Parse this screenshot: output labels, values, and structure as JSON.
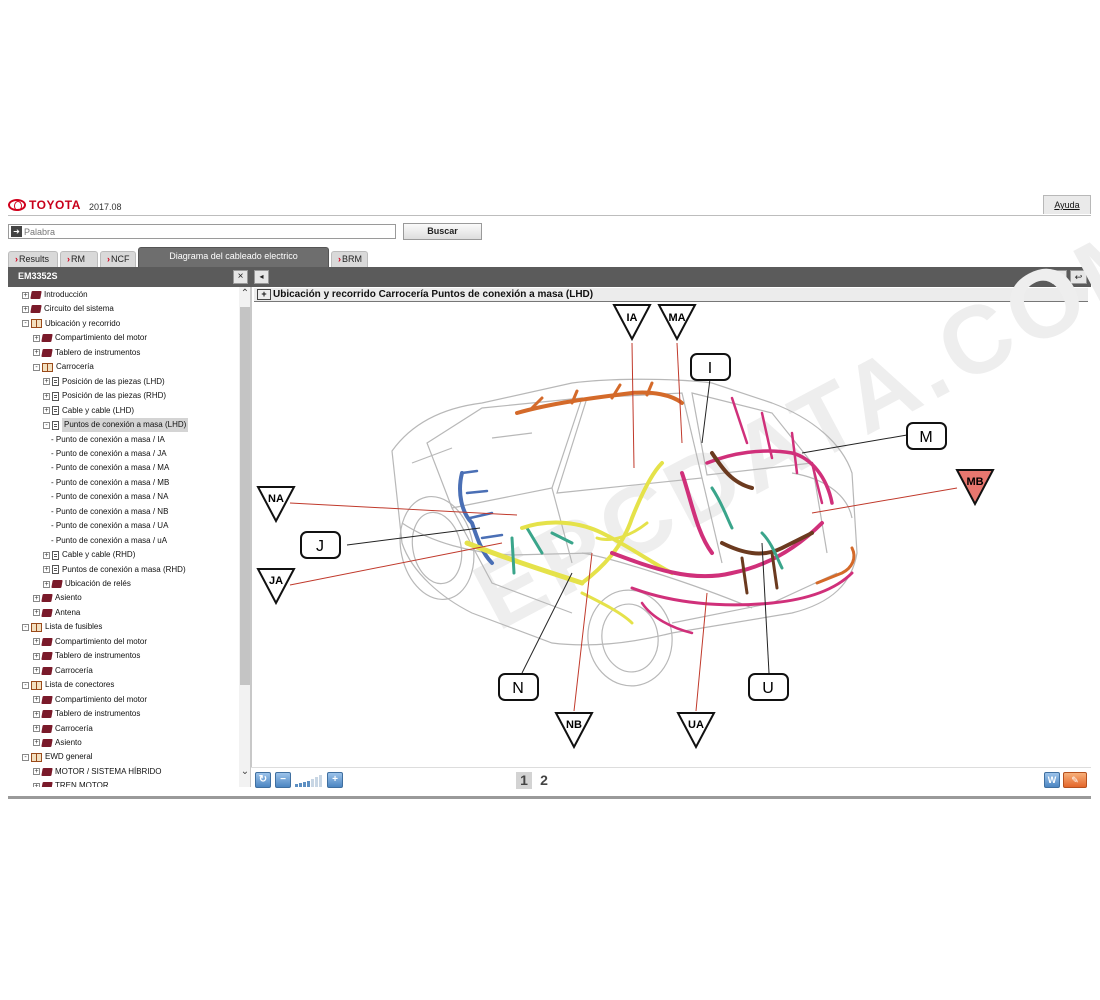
{
  "header": {
    "brand": "TOYOTA",
    "version": "2017.08",
    "help": "Ayuda"
  },
  "search": {
    "placeholder": "Palabra",
    "value": "",
    "button": "Buscar"
  },
  "tabs": [
    {
      "label": "Results"
    },
    {
      "label": "RM"
    },
    {
      "label": "NCF"
    },
    {
      "label": "Diagrama del cableado electrico"
    },
    {
      "label": "BRM"
    }
  ],
  "toolbar": {
    "doc_id": "EM3352S",
    "close": "×",
    "nav": "◂",
    "print": "⎙",
    "back": "↩"
  },
  "breadcrumb": {
    "expand": "+",
    "text": "Ubicación y recorrido  Carrocería  Puntos de conexión a masa (LHD)"
  },
  "tree": [
    {
      "exp": "+",
      "icon": "book",
      "label": "Introducción"
    },
    {
      "exp": "+",
      "icon": "book",
      "label": "Circuito del sistema"
    },
    {
      "exp": "-",
      "icon": "open",
      "label": "Ubicación y recorrido"
    },
    {
      "exp": "+",
      "icon": "book",
      "label": "Compartimiento del motor"
    },
    {
      "exp": "+",
      "icon": "book",
      "label": "Tablero de instrumentos"
    },
    {
      "exp": "-",
      "icon": "open",
      "label": "Carrocería"
    },
    {
      "exp": "+",
      "icon": "doc",
      "label": "Posición de las piezas (LHD)"
    },
    {
      "exp": "+",
      "icon": "doc",
      "label": "Posición de las piezas (RHD)"
    },
    {
      "exp": "+",
      "icon": "doc",
      "label": "Cable y cable (LHD)"
    },
    {
      "exp": "-",
      "icon": "doc",
      "label": "Puntos de conexión a masa (LHD)"
    },
    {
      "exp": "",
      "icon": "",
      "label": "- Punto de conexión a masa / IA"
    },
    {
      "exp": "",
      "icon": "",
      "label": "- Punto de conexión a masa / JA"
    },
    {
      "exp": "",
      "icon": "",
      "label": "- Punto de conexión a masa / MA"
    },
    {
      "exp": "",
      "icon": "",
      "label": "- Punto de conexión a masa / MB"
    },
    {
      "exp": "",
      "icon": "",
      "label": "- Punto de conexión a masa / NA"
    },
    {
      "exp": "",
      "icon": "",
      "label": "- Punto de conexión a masa / NB"
    },
    {
      "exp": "",
      "icon": "",
      "label": "- Punto de conexión a masa / UA"
    },
    {
      "exp": "",
      "icon": "",
      "label": "- Punto de conexión a masa / uA"
    },
    {
      "exp": "+",
      "icon": "doc",
      "label": "Cable y cable (RHD)"
    },
    {
      "exp": "+",
      "icon": "doc",
      "label": "Puntos de conexión a masa (RHD)"
    },
    {
      "exp": "+",
      "icon": "book",
      "label": "Ubicación de relés"
    },
    {
      "exp": "+",
      "icon": "book",
      "label": "Asiento"
    },
    {
      "exp": "+",
      "icon": "book",
      "label": "Antena"
    },
    {
      "exp": "-",
      "icon": "open",
      "label": "Lista de fusibles"
    },
    {
      "exp": "+",
      "icon": "book",
      "label": "Compartimiento del motor"
    },
    {
      "exp": "+",
      "icon": "book",
      "label": "Tablero de instrumentos"
    },
    {
      "exp": "+",
      "icon": "book",
      "label": "Carrocería"
    },
    {
      "exp": "-",
      "icon": "open",
      "label": "Lista de conectores"
    },
    {
      "exp": "+",
      "icon": "book",
      "label": "Compartimiento del motor"
    },
    {
      "exp": "+",
      "icon": "book",
      "label": "Tablero de instrumentos"
    },
    {
      "exp": "+",
      "icon": "book",
      "label": "Carrocería"
    },
    {
      "exp": "+",
      "icon": "book",
      "label": "Asiento"
    },
    {
      "exp": "-",
      "icon": "open",
      "label": "EWD general"
    },
    {
      "exp": "+",
      "icon": "book",
      "label": "MOTOR / SISTEMA HÍBRIDO"
    },
    {
      "exp": "+",
      "icon": "book",
      "label": "TREN MOTOR"
    }
  ],
  "selected_index": 9,
  "diagram": {
    "watermark": "EPCDATA.COM",
    "markers": {
      "IA": "IA",
      "MA": "MA",
      "I": "I",
      "M": "M",
      "MB": "MB",
      "NA": "NA",
      "J": "J",
      "JA": "JA",
      "N": "N",
      "NB": "NB",
      "UA": "UA",
      "U": "U"
    },
    "colors": {
      "leader": "#c0392b",
      "highlight": "#e8776f",
      "wire_yellow": "#e5e24a",
      "wire_pink": "#d0307a",
      "wire_brown": "#6b3a1f",
      "wire_orange": "#d46a2a",
      "wire_blue": "#4a6fb5",
      "wire_green": "#3aa58b"
    }
  },
  "pager": {
    "pages": [
      "1",
      "2"
    ],
    "current": "1"
  },
  "bottom": {
    "word_btn": "W"
  }
}
